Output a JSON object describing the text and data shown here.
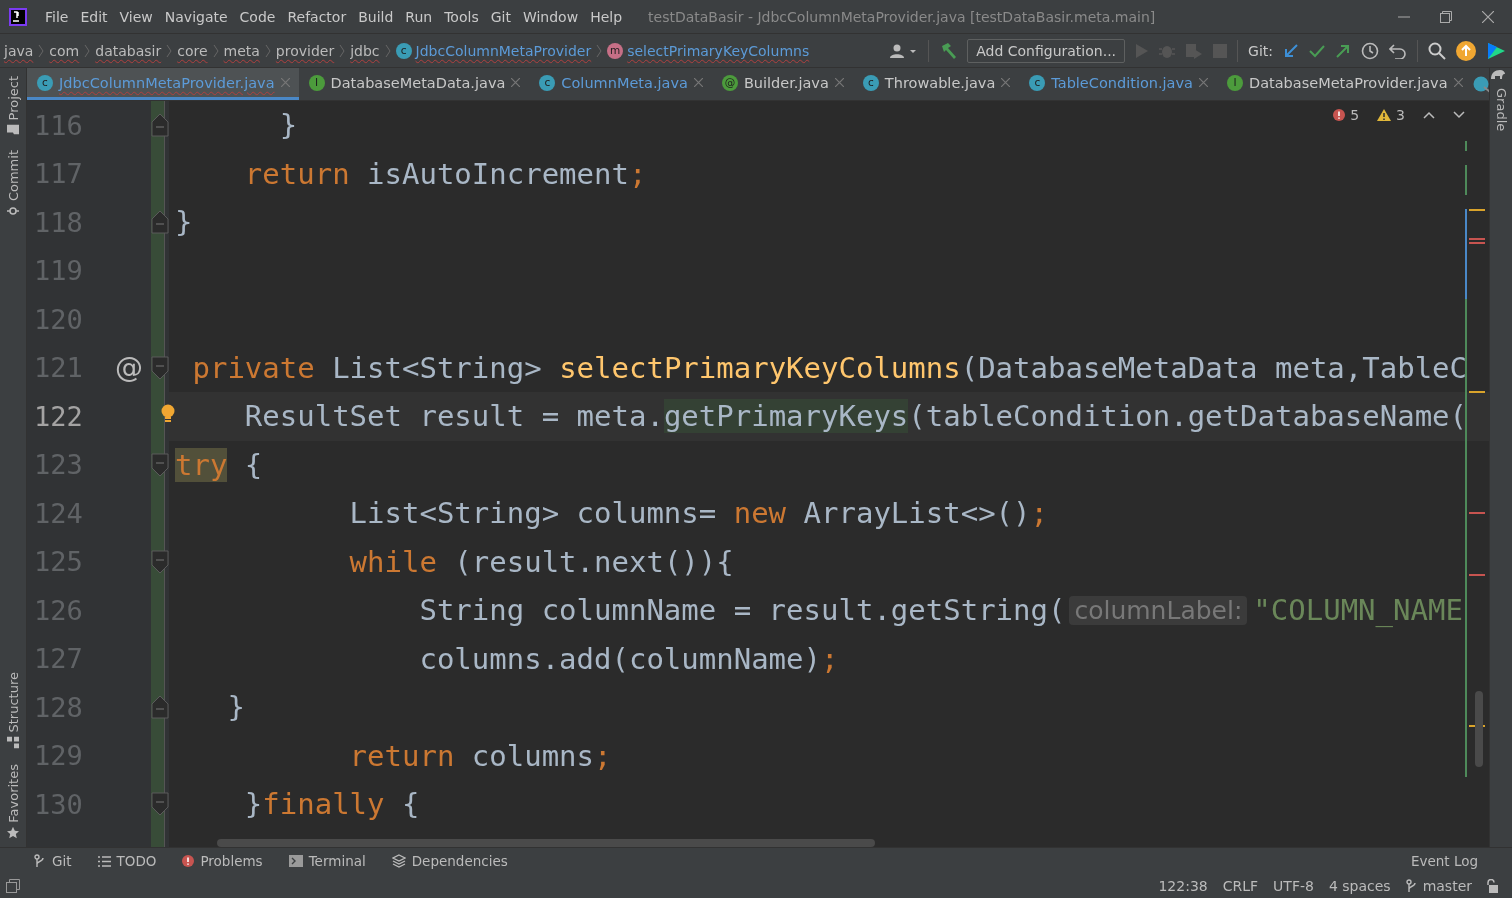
{
  "title_bar": {
    "menu": [
      "File",
      "Edit",
      "View",
      "Navigate",
      "Code",
      "Refactor",
      "Build",
      "Run",
      "Tools",
      "Git",
      "Window",
      "Help"
    ],
    "title": "testDataBasir - JdbcColumnMetaProvider.java [testDataBasir.meta.main]"
  },
  "nav_bar": {
    "breadcrumbs": [
      {
        "label": "java",
        "kind": "package"
      },
      {
        "label": "com",
        "kind": "package"
      },
      {
        "label": "databasir",
        "kind": "package"
      },
      {
        "label": "core",
        "kind": "package"
      },
      {
        "label": "meta",
        "kind": "package"
      },
      {
        "label": "provider",
        "kind": "package"
      },
      {
        "label": "jdbc",
        "kind": "package"
      },
      {
        "label": "JdbcColumnMetaProvider",
        "kind": "class",
        "icon": "c"
      },
      {
        "label": "selectPrimaryKeyColumns",
        "kind": "method",
        "icon": "m"
      }
    ],
    "run_config": "Add Configuration...",
    "git_label": "Git:"
  },
  "left_stripe": {
    "top": [
      "Project",
      "Commit"
    ],
    "bottom": [
      "Structure",
      "Favorites"
    ]
  },
  "right_stripe": [
    "Gradle"
  ],
  "tabs": [
    {
      "label": "JdbcColumnMetaProvider.java",
      "kind": "class",
      "icon": "c",
      "color": "#5c9bd8",
      "selected": true
    },
    {
      "label": "DatabaseMetaData.java",
      "kind": "interface",
      "icon": "I",
      "color": "#c8c8c8",
      "selected": false
    },
    {
      "label": "ColumnMeta.java",
      "kind": "class",
      "icon": "c",
      "color": "#5c9bd8",
      "selected": false
    },
    {
      "label": "Builder.java",
      "kind": "annotation",
      "icon": "@",
      "color": "#c8c8c8",
      "selected": false
    },
    {
      "label": "Throwable.java",
      "kind": "class",
      "icon": "c",
      "color": "#c8c8c8",
      "selected": false
    },
    {
      "label": "TableCondition.java",
      "kind": "class",
      "icon": "c",
      "color": "#5c9bd8",
      "selected": false
    },
    {
      "label": "DatabaseMetaProvider.java",
      "kind": "interface",
      "icon": "I",
      "color": "#c8c8c8",
      "selected": false
    }
  ],
  "inspections": {
    "errors": "5",
    "warnings": "3"
  },
  "editor": {
    "lines": [
      {
        "number": "116",
        "current": false,
        "fold_start": false,
        "fold_end": true,
        "tokens": [
          {
            "kind": "plain",
            "text": "      }"
          }
        ]
      },
      {
        "number": "117",
        "current": false,
        "fold_start": false,
        "fold_end": false,
        "tokens": [
          {
            "kind": "keyword",
            "text": "    return"
          },
          {
            "kind": "plain",
            "text": " isAutoIncrement"
          },
          {
            "kind": "keyword",
            "text": ";"
          }
        ]
      },
      {
        "number": "118",
        "current": false,
        "fold_start": false,
        "fold_end": true,
        "tokens": [
          {
            "kind": "plain",
            "text": "}"
          }
        ]
      },
      {
        "number": "119",
        "current": false,
        "fold_start": false,
        "fold_end": false
      },
      {
        "number": "120",
        "current": false,
        "fold_start": false,
        "fold_end": false
      },
      {
        "number": "121",
        "current": false,
        "marker": "@",
        "fold_start": true,
        "fold_end": false,
        "tokens": [
          {
            "kind": "keyword",
            "text": " private"
          },
          {
            "kind": "plain",
            "text": " List<String> "
          },
          {
            "kind": "method",
            "text": "selectPrimaryKeyColumns"
          },
          {
            "kind": "plain",
            "text": "(DatabaseMetaData meta,TableC"
          }
        ]
      },
      {
        "number": "122",
        "current": true,
        "bulb": true,
        "fold_start": false,
        "fold_end": false,
        "tokens": [
          {
            "kind": "plain",
            "text": "    ResultSet result = meta."
          },
          {
            "kind": "match",
            "text": "getPrimaryKeys"
          },
          {
            "kind": "plain",
            "text": "(tableCondition.getDatabaseName("
          }
        ]
      },
      {
        "number": "123",
        "current": false,
        "fold_start": true,
        "fold_end": false,
        "tokens": [
          {
            "kind": "keyword_match",
            "text": "try"
          },
          {
            "kind": "plain",
            "text": " {"
          }
        ]
      },
      {
        "number": "124",
        "current": false,
        "fold_start": false,
        "fold_end": false,
        "tokens": [
          {
            "kind": "plain",
            "text": "          List<String> columns= "
          },
          {
            "kind": "keyword",
            "text": "new"
          },
          {
            "kind": "plain",
            "text": " ArrayList<>()"
          },
          {
            "kind": "keyword",
            "text": ";"
          }
        ]
      },
      {
        "number": "125",
        "current": false,
        "fold_start": true,
        "fold_end": false,
        "tokens": [
          {
            "kind": "keyword",
            "text": "          while"
          },
          {
            "kind": "plain",
            "text": " (result.next()){"
          }
        ]
      },
      {
        "number": "126",
        "current": false,
        "fold_start": false,
        "fold_end": false,
        "tokens": [
          {
            "kind": "plain",
            "text": "              String columnName = result.getString("
          },
          {
            "kind": "hint",
            "text": "columnLabel:"
          },
          {
            "kind": "string",
            "text": "\"COLUMN_NAME"
          }
        ]
      },
      {
        "number": "127",
        "current": false,
        "fold_start": false,
        "fold_end": false,
        "tokens": [
          {
            "kind": "plain",
            "text": "              columns.add(columnName)"
          },
          {
            "kind": "keyword",
            "text": ";"
          }
        ]
      },
      {
        "number": "128",
        "current": false,
        "fold_start": false,
        "fold_end": true,
        "tokens": [
          {
            "kind": "plain",
            "text": "   }"
          }
        ]
      },
      {
        "number": "129",
        "current": false,
        "fold_start": false,
        "fold_end": false,
        "tokens": [
          {
            "kind": "keyword",
            "text": "          return"
          },
          {
            "kind": "plain",
            "text": " columns"
          },
          {
            "kind": "keyword",
            "text": ";"
          }
        ]
      },
      {
        "number": "130",
        "current": false,
        "fold_start": true,
        "fold_end": false,
        "tokens": [
          {
            "kind": "plain",
            "text": "    }"
          },
          {
            "kind": "keyword",
            "text": "finally"
          },
          {
            "kind": "plain",
            "text": " {"
          }
        ]
      }
    ]
  },
  "tool_windows": [
    {
      "label": "Git",
      "kind": "git"
    },
    {
      "label": "TODO",
      "kind": "todo"
    },
    {
      "label": "Problems",
      "kind": "problems"
    },
    {
      "label": "Terminal",
      "kind": "terminal"
    },
    {
      "label": "Dependencies",
      "kind": "dependencies"
    }
  ],
  "event_log": "Event Log",
  "status_bar": {
    "position": "122:38",
    "line_separator": "CRLF",
    "encoding": "UTF-8",
    "indent": "4 spaces",
    "branch": "master"
  }
}
